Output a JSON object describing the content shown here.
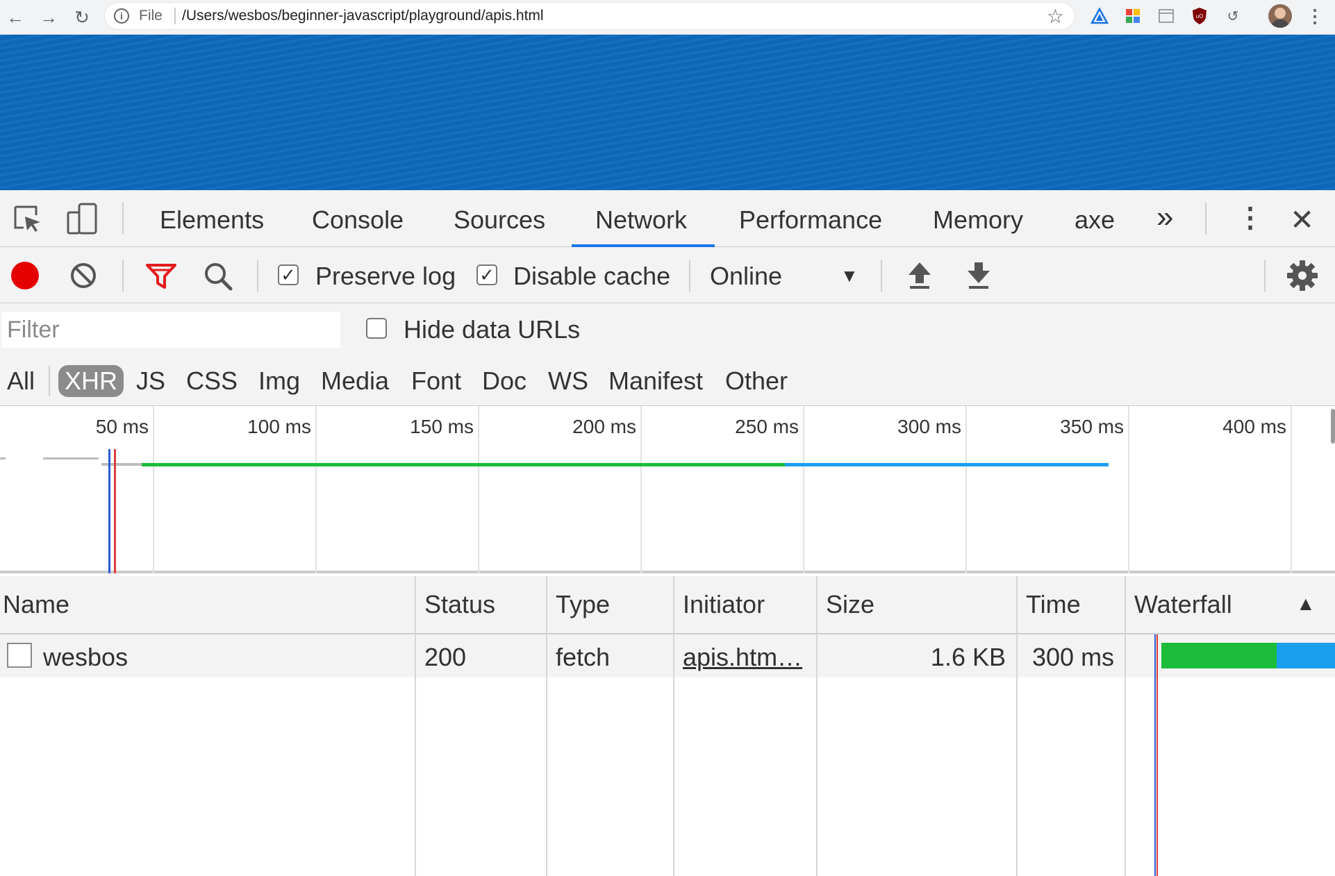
{
  "browser": {
    "scheme": "File",
    "url": "/Users/wesbos/beginner-javascript/playground/apis.html",
    "icons": [
      "back-arrow-icon",
      "forward-arrow-icon",
      "reload-icon",
      "info-icon",
      "star-icon",
      "triangle-extension-icon",
      "color-picker-extension-icon",
      "window-extension-icon",
      "ublock-extension-icon",
      "history-extension-icon",
      "profile-avatar",
      "kebab-menu-icon"
    ],
    "accent": "#0d6bbd"
  },
  "devtools": {
    "tabs": [
      "Elements",
      "Console",
      "Sources",
      "Network",
      "Performance",
      "Memory",
      "axe"
    ],
    "active_tab": "Network",
    "more_tabs": "»",
    "close": "✕"
  },
  "toolbar": {
    "preserve_log": {
      "label": "Preserve log",
      "checked": true
    },
    "disable_cache": {
      "label": "Disable cache",
      "checked": true
    },
    "throttling": "Online",
    "record_color": "#e50000"
  },
  "filter": {
    "placeholder": "Filter",
    "hide_data_urls": {
      "label": "Hide data URLs",
      "checked": false
    }
  },
  "types": [
    "All",
    "XHR",
    "JS",
    "CSS",
    "Img",
    "Media",
    "Font",
    "Doc",
    "WS",
    "Manifest",
    "Other"
  ],
  "active_type": "XHR",
  "overview": {
    "ticks": [
      "50 ms",
      "100 ms",
      "150 ms",
      "200 ms",
      "250 ms",
      "300 ms",
      "350 ms",
      "400 ms"
    ],
    "green_color": "#1bbd3b",
    "blue_color": "#1a9fef"
  },
  "table": {
    "columns": [
      "Name",
      "Status",
      "Type",
      "Initiator",
      "Size",
      "Time",
      "Waterfall"
    ],
    "sort_indicator": "▲",
    "rows": [
      {
        "name": "wesbos",
        "status": "200",
        "type": "fetch",
        "initiator": "apis.htm…",
        "size": "1.6 KB",
        "time": "300 ms"
      }
    ]
  }
}
